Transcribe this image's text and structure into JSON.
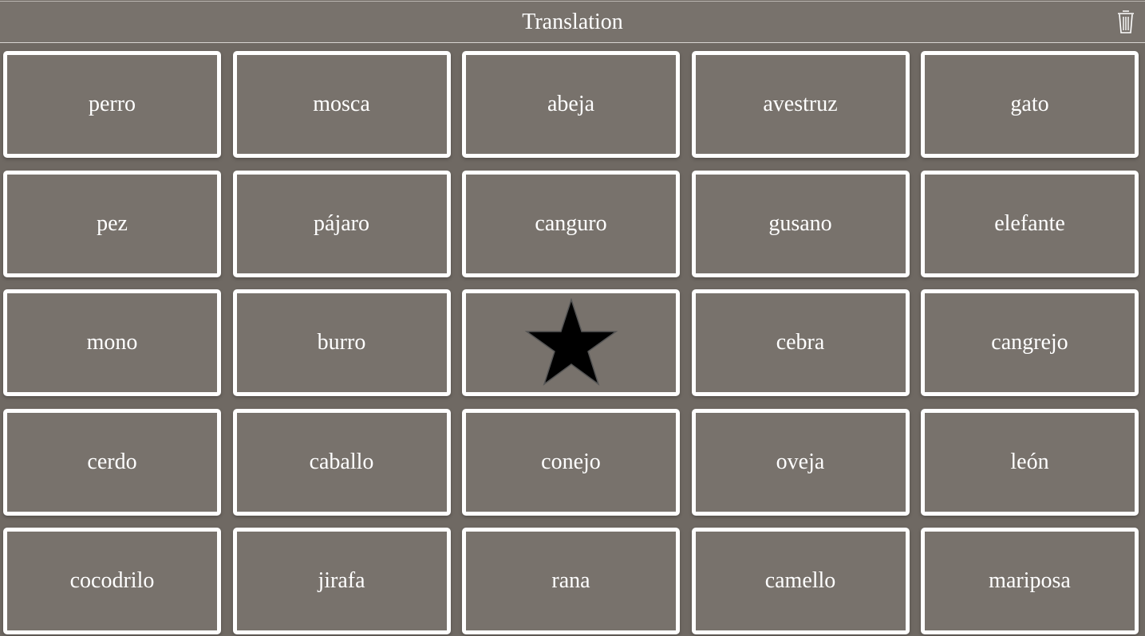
{
  "header": {
    "title": "Translation",
    "trash_icon": "trash-icon"
  },
  "colors": {
    "background": "#78726c",
    "card_border": "#ffffff",
    "star": "#000000"
  },
  "cards": [
    "perro",
    "mosca",
    "abeja",
    "avestruz",
    "gato",
    "pez",
    "pájaro",
    "canguro",
    "gusano",
    "elefante",
    "mono",
    "burro",
    "★",
    "cebra",
    "cangrejo",
    "cerdo",
    "caballo",
    "conejo",
    "oveja",
    "león",
    "cocodrilo",
    "jirafa",
    "rana",
    "camello",
    "mariposa"
  ]
}
